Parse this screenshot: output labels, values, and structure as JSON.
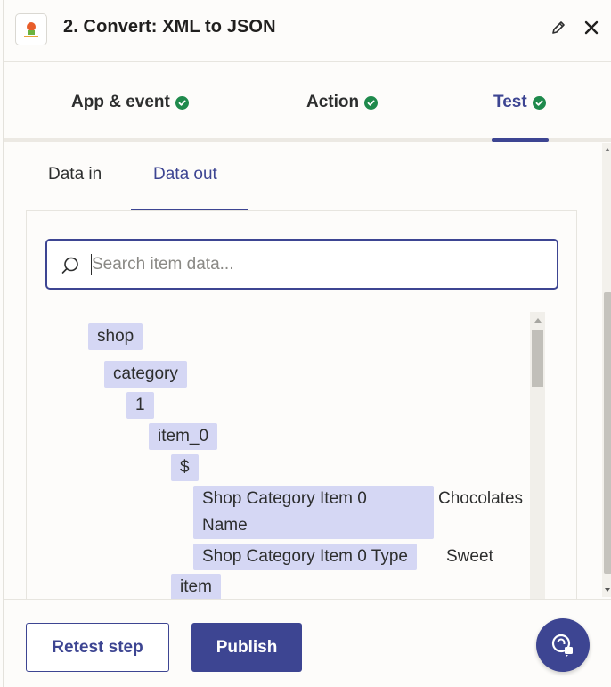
{
  "header": {
    "title": "2. Convert: XML to JSON",
    "app_icon": "app-logo-icon",
    "edit_icon": "pencil-icon",
    "close_icon": "close-icon"
  },
  "steps": {
    "items": [
      {
        "label": "App & event",
        "status": "complete"
      },
      {
        "label": "Action",
        "status": "complete"
      },
      {
        "label": "Test",
        "status": "complete",
        "active": true
      }
    ]
  },
  "data_tabs": {
    "data_in": "Data in",
    "data_out": "Data out",
    "active": "Data out"
  },
  "search": {
    "placeholder": "Search item data...",
    "value": ""
  },
  "tree": {
    "nodes": [
      {
        "key": "shop",
        "depth": 0
      },
      {
        "key": "category",
        "depth": 1
      },
      {
        "key": "1",
        "depth": 2
      },
      {
        "key": "item_0",
        "depth": 3
      },
      {
        "key": "$",
        "depth": 4
      },
      {
        "key_line1": "Shop Category Item 0",
        "key_line2": "Name",
        "value": "Chocolates",
        "depth": 5
      },
      {
        "key": "Shop Category Item 0 Type",
        "value": "Sweet",
        "depth": 5
      },
      {
        "key": "item",
        "depth": 4
      }
    ]
  },
  "footer": {
    "retest_label": "Retest step",
    "publish_label": "Publish",
    "help_icon": "support-chat-icon"
  },
  "colors": {
    "accent": "#3d4592",
    "success": "#1f8a4c",
    "node_bg": "#d5d7f4",
    "background": "#fdfcfa"
  }
}
